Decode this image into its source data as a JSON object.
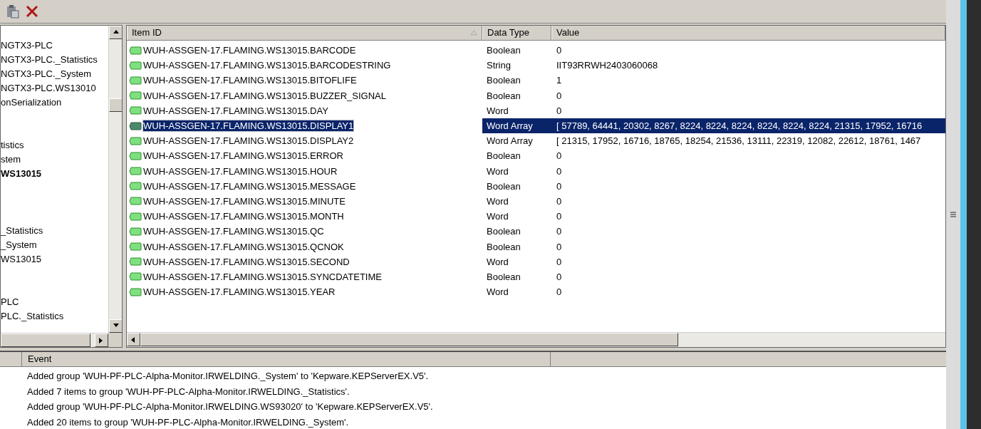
{
  "tree": {
    "items": [
      {
        "kind": "item",
        "text": "NGTX3-PLC",
        "selected": false
      },
      {
        "kind": "item",
        "text": "NGTX3-PLC._Statistics",
        "selected": false
      },
      {
        "kind": "item",
        "text": "NGTX3-PLC._System",
        "selected": false
      },
      {
        "kind": "item",
        "text": "NGTX3-PLC.WS13010",
        "selected": false
      },
      {
        "kind": "item",
        "text": "onSerialization",
        "selected": false
      },
      {
        "kind": "blank"
      },
      {
        "kind": "blank"
      },
      {
        "kind": "item",
        "text": "tistics",
        "selected": false
      },
      {
        "kind": "item",
        "text": "stem",
        "selected": false
      },
      {
        "kind": "item",
        "text": "WS13015",
        "selected": true
      },
      {
        "kind": "blank"
      },
      {
        "kind": "blank"
      },
      {
        "kind": "blank"
      },
      {
        "kind": "item",
        "text": "_Statistics",
        "selected": false
      },
      {
        "kind": "item",
        "text": "_System",
        "selected": false
      },
      {
        "kind": "item",
        "text": "WS13015",
        "selected": false
      },
      {
        "kind": "blank"
      },
      {
        "kind": "blank"
      },
      {
        "kind": "item",
        "text": "PLC",
        "selected": false
      },
      {
        "kind": "item",
        "text": "PLC._Statistics",
        "selected": false
      }
    ]
  },
  "items_table": {
    "columns": [
      "Item ID",
      "Data Type",
      "Value"
    ],
    "rows": [
      {
        "item_id": "WUH-ASSGEN-17.FLAMING.WS13015.BARCODE",
        "data_type": "Boolean",
        "value": "0",
        "selected": false
      },
      {
        "item_id": "WUH-ASSGEN-17.FLAMING.WS13015.BARCODESTRING",
        "data_type": "String",
        "value": "IIT93RRWH2403060068",
        "selected": false
      },
      {
        "item_id": "WUH-ASSGEN-17.FLAMING.WS13015.BITOFLIFE",
        "data_type": "Boolean",
        "value": "1",
        "selected": false
      },
      {
        "item_id": "WUH-ASSGEN-17.FLAMING.WS13015.BUZZER_SIGNAL",
        "data_type": "Boolean",
        "value": "0",
        "selected": false
      },
      {
        "item_id": "WUH-ASSGEN-17.FLAMING.WS13015.DAY",
        "data_type": "Word",
        "value": "0",
        "selected": false
      },
      {
        "item_id": "WUH-ASSGEN-17.FLAMING.WS13015.DISPLAY1",
        "data_type": "Word Array",
        "value": "[ 57789, 64441, 20302, 8267, 8224, 8224, 8224, 8224, 8224, 8224, 21315, 17952, 16716",
        "selected": true
      },
      {
        "item_id": "WUH-ASSGEN-17.FLAMING.WS13015.DISPLAY2",
        "data_type": "Word Array",
        "value": "[ 21315, 17952, 16716, 18765, 18254, 21536, 13111, 22319, 12082, 22612, 18761, 1467",
        "selected": false
      },
      {
        "item_id": "WUH-ASSGEN-17.FLAMING.WS13015.ERROR",
        "data_type": "Boolean",
        "value": "0",
        "selected": false
      },
      {
        "item_id": "WUH-ASSGEN-17.FLAMING.WS13015.HOUR",
        "data_type": "Word",
        "value": "0",
        "selected": false
      },
      {
        "item_id": "WUH-ASSGEN-17.FLAMING.WS13015.MESSAGE",
        "data_type": "Boolean",
        "value": "0",
        "selected": false
      },
      {
        "item_id": "WUH-ASSGEN-17.FLAMING.WS13015.MINUTE",
        "data_type": "Word",
        "value": "0",
        "selected": false
      },
      {
        "item_id": "WUH-ASSGEN-17.FLAMING.WS13015.MONTH",
        "data_type": "Word",
        "value": "0",
        "selected": false
      },
      {
        "item_id": "WUH-ASSGEN-17.FLAMING.WS13015.QC",
        "data_type": "Boolean",
        "value": "0",
        "selected": false
      },
      {
        "item_id": "WUH-ASSGEN-17.FLAMING.WS13015.QCNOK",
        "data_type": "Boolean",
        "value": "0",
        "selected": false
      },
      {
        "item_id": "WUH-ASSGEN-17.FLAMING.WS13015.SECOND",
        "data_type": "Word",
        "value": "0",
        "selected": false
      },
      {
        "item_id": "WUH-ASSGEN-17.FLAMING.WS13015.SYNCDATETIME",
        "data_type": "Boolean",
        "value": "0",
        "selected": false
      },
      {
        "item_id": "WUH-ASSGEN-17.FLAMING.WS13015.YEAR",
        "data_type": "Word",
        "value": "0",
        "selected": false
      }
    ]
  },
  "event_log": {
    "columns": [
      "Event"
    ],
    "rows": [
      "Added group 'WUH-PF-PLC-Alpha-Monitor.IRWELDING._System' to 'Kepware.KEPServerEX.V5'.",
      "Added 7 items to group 'WUH-PF-PLC-Alpha-Monitor.IRWELDING._Statistics'.",
      "Added group 'WUH-PF-PLC-Alpha-Monitor.IRWELDING.WS93020' to 'Kepware.KEPServerEX.V5'.",
      "Added 20 items to group 'WUH-PF-PLC-Alpha-Monitor.IRWELDING._System'."
    ]
  }
}
